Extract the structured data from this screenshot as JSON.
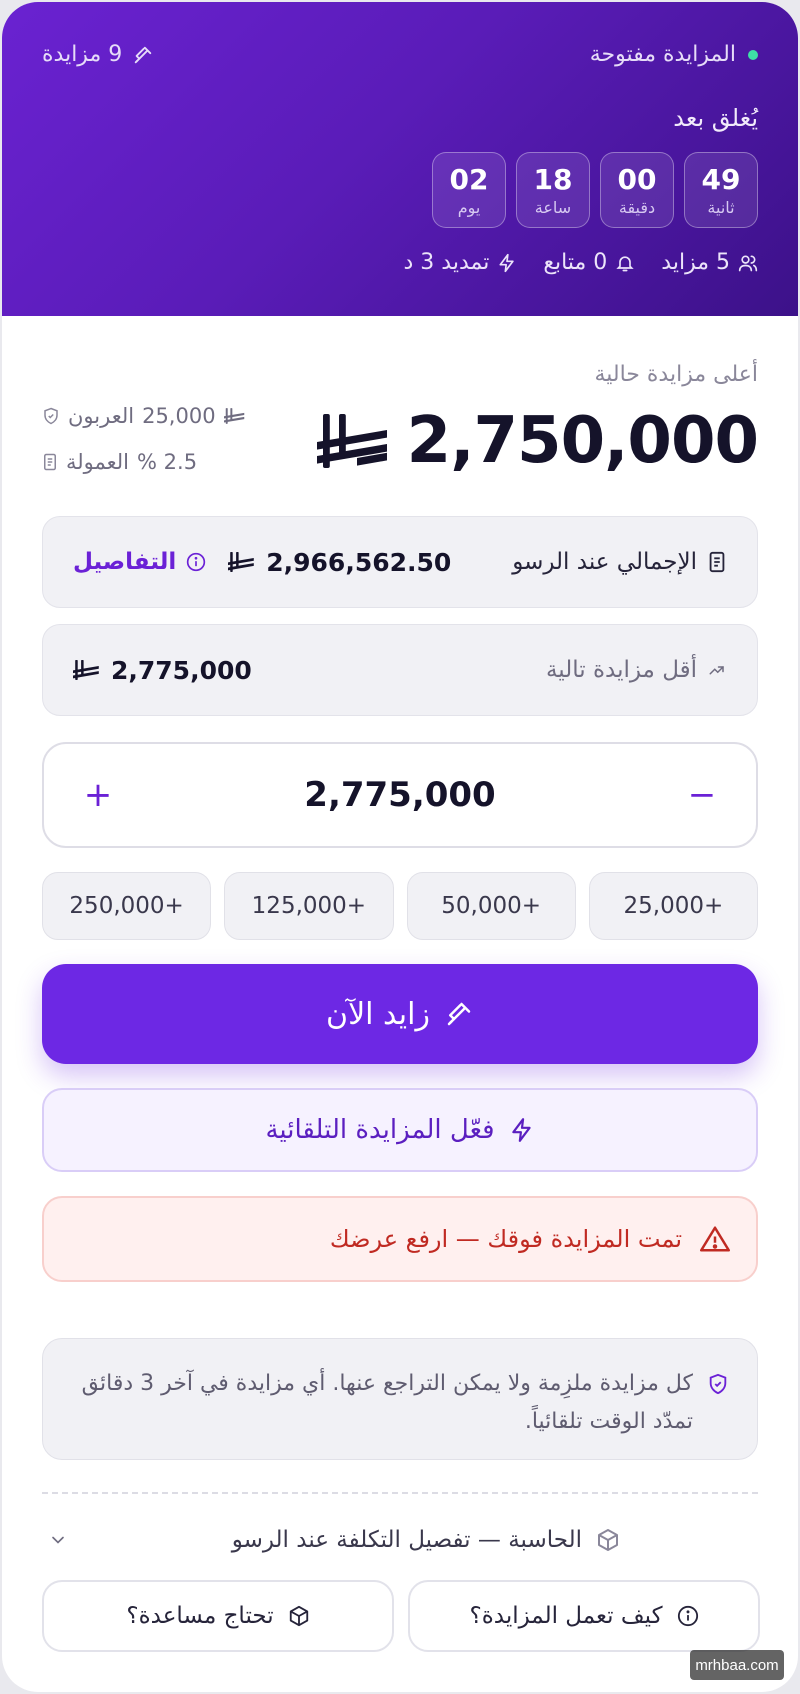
{
  "header": {
    "status_text": "المزايدة مفتوحة",
    "bid_count_text": "9 مزايدة",
    "closes_label": "يُغلق بعد",
    "countdown": [
      {
        "value": "49",
        "label": "ثانية"
      },
      {
        "value": "00",
        "label": "دقيقة"
      },
      {
        "value": "18",
        "label": "ساعة"
      },
      {
        "value": "02",
        "label": "يوم"
      }
    ],
    "stats": {
      "bidders": "5 مزايد",
      "followers": "0 متابع",
      "extension": "تمديد 3 د"
    }
  },
  "pricing": {
    "highest_label": "أعلى مزايدة حالية",
    "highest_value": "2,750,000",
    "deposit_label": "العربون",
    "deposit_value": "25,000",
    "commission_label": "العمولة",
    "commission_value": "2.5 %",
    "total_label": "الإجمالي عند الرسو",
    "total_value": "2,966,562.50",
    "details_link": "التفاصيل",
    "min_next_label": "أقل مزايدة تالية",
    "min_next_value": "2,775,000"
  },
  "stepper": {
    "value": "2,775,000",
    "plus": "+",
    "minus": "−"
  },
  "increments": [
    "+25,000",
    "+50,000",
    "+125,000",
    "+250,000"
  ],
  "actions": {
    "bid_now": "زايد الآن",
    "auto_bid": "فعّل المزايدة التلقائية"
  },
  "alert": {
    "text": "تمت المزايدة فوقك — ارفع عرضك"
  },
  "notice": {
    "text": "كل مزايدة ملزِمة ولا يمكن التراجع عنها. أي مزايدة في آخر 3 دقائق تمدّد الوقت تلقائياً."
  },
  "calculator": {
    "label": "الحاسبة — تفصيل التكلفة عند الرسو"
  },
  "footer": {
    "how_it_works": "كيف تعمل المزايدة؟",
    "need_help": "تحتاج مساعدة؟"
  },
  "watermark": "mrhbaa.com",
  "colors": {
    "accent": "#6d28e4",
    "header_gradient_start": "#6a22d1",
    "header_gradient_end": "#3c1189",
    "status_dot": "#3ee0a6",
    "alert_text": "#c02a22"
  }
}
